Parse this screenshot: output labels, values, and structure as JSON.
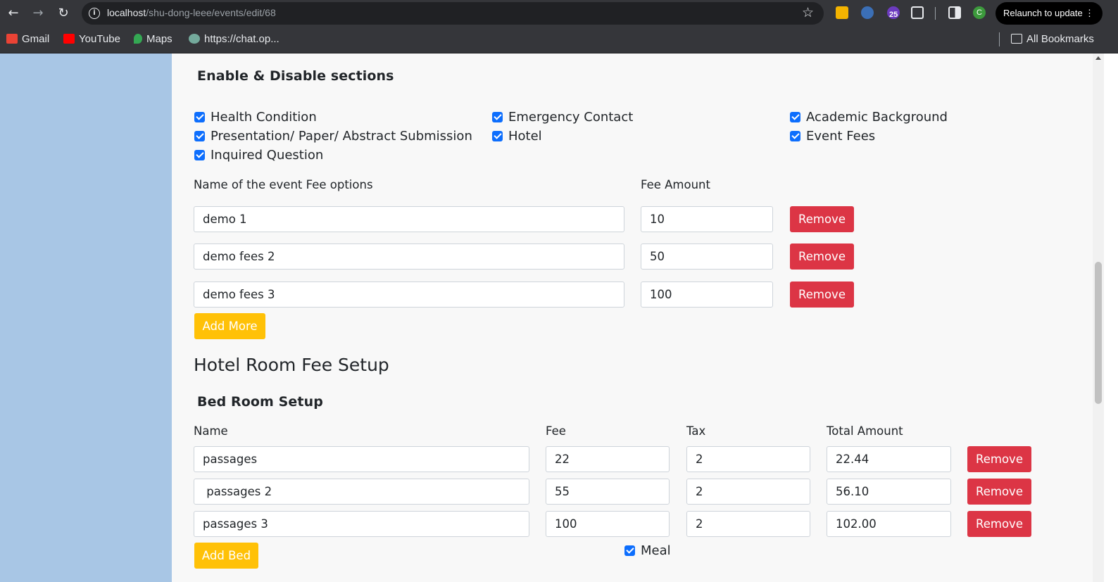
{
  "browser": {
    "url_host": "localhost",
    "url_path": "/shu-dong-leee/events/edit/68",
    "ext_badge": "25",
    "profile_initial": "C",
    "relaunch_label": "Relaunch to update",
    "bookmarks": [
      {
        "label": "Gmail",
        "icon": "gmail-icon",
        "color": "#ea4335"
      },
      {
        "label": "YouTube",
        "icon": "youtube-icon",
        "color": "#ff0000"
      },
      {
        "label": "Maps",
        "icon": "maps-icon",
        "color": "#34a853"
      },
      {
        "label": "https://chat.op...",
        "icon": "chatgpt-icon",
        "color": "#74aa9c"
      }
    ],
    "all_bookmarks_label": "All Bookmarks"
  },
  "sections": {
    "title": "Enable & Disable sections",
    "checkboxes": [
      {
        "label": "Health Condition",
        "checked": true
      },
      {
        "label": "Emergency Contact",
        "checked": true
      },
      {
        "label": "Academic Background",
        "checked": true
      },
      {
        "label": "Presentation/ Paper/ Abstract Submission",
        "checked": true
      },
      {
        "label": "Hotel",
        "checked": true
      },
      {
        "label": "Event Fees",
        "checked": true
      },
      {
        "label": "Inquired Question",
        "checked": true
      }
    ]
  },
  "event_fees": {
    "name_header": "Name of the event Fee options",
    "amount_header": "Fee Amount",
    "rows": [
      {
        "name": "demo 1",
        "amount": "10"
      },
      {
        "name": "demo fees 2",
        "amount": "50"
      },
      {
        "name": "demo fees 3",
        "amount": "100"
      }
    ],
    "remove_label": "Remove",
    "add_more_label": "Add More"
  },
  "hotel": {
    "title": "Hotel Room Fee Setup",
    "bed_title": "Bed Room Setup",
    "headers": {
      "name": "Name",
      "fee": "Fee",
      "tax": "Tax",
      "total": "Total Amount"
    },
    "rows": [
      {
        "name": "passages",
        "fee": "22",
        "tax": "2",
        "total": "22.44"
      },
      {
        "name": " passages 2",
        "fee": "55",
        "tax": "2",
        "total": "56.10"
      },
      {
        "name": "passages 3",
        "fee": "100",
        "tax": "2",
        "total": "102.00"
      }
    ],
    "remove_label": "Remove",
    "add_bed_label": "Add Bed",
    "meal_label": "Meal",
    "meal_checked": true
  },
  "colors": {
    "primary": "#0d6efd",
    "danger": "#dc3545",
    "warning": "#ffc107",
    "sidebar": "#a8c6e5"
  }
}
